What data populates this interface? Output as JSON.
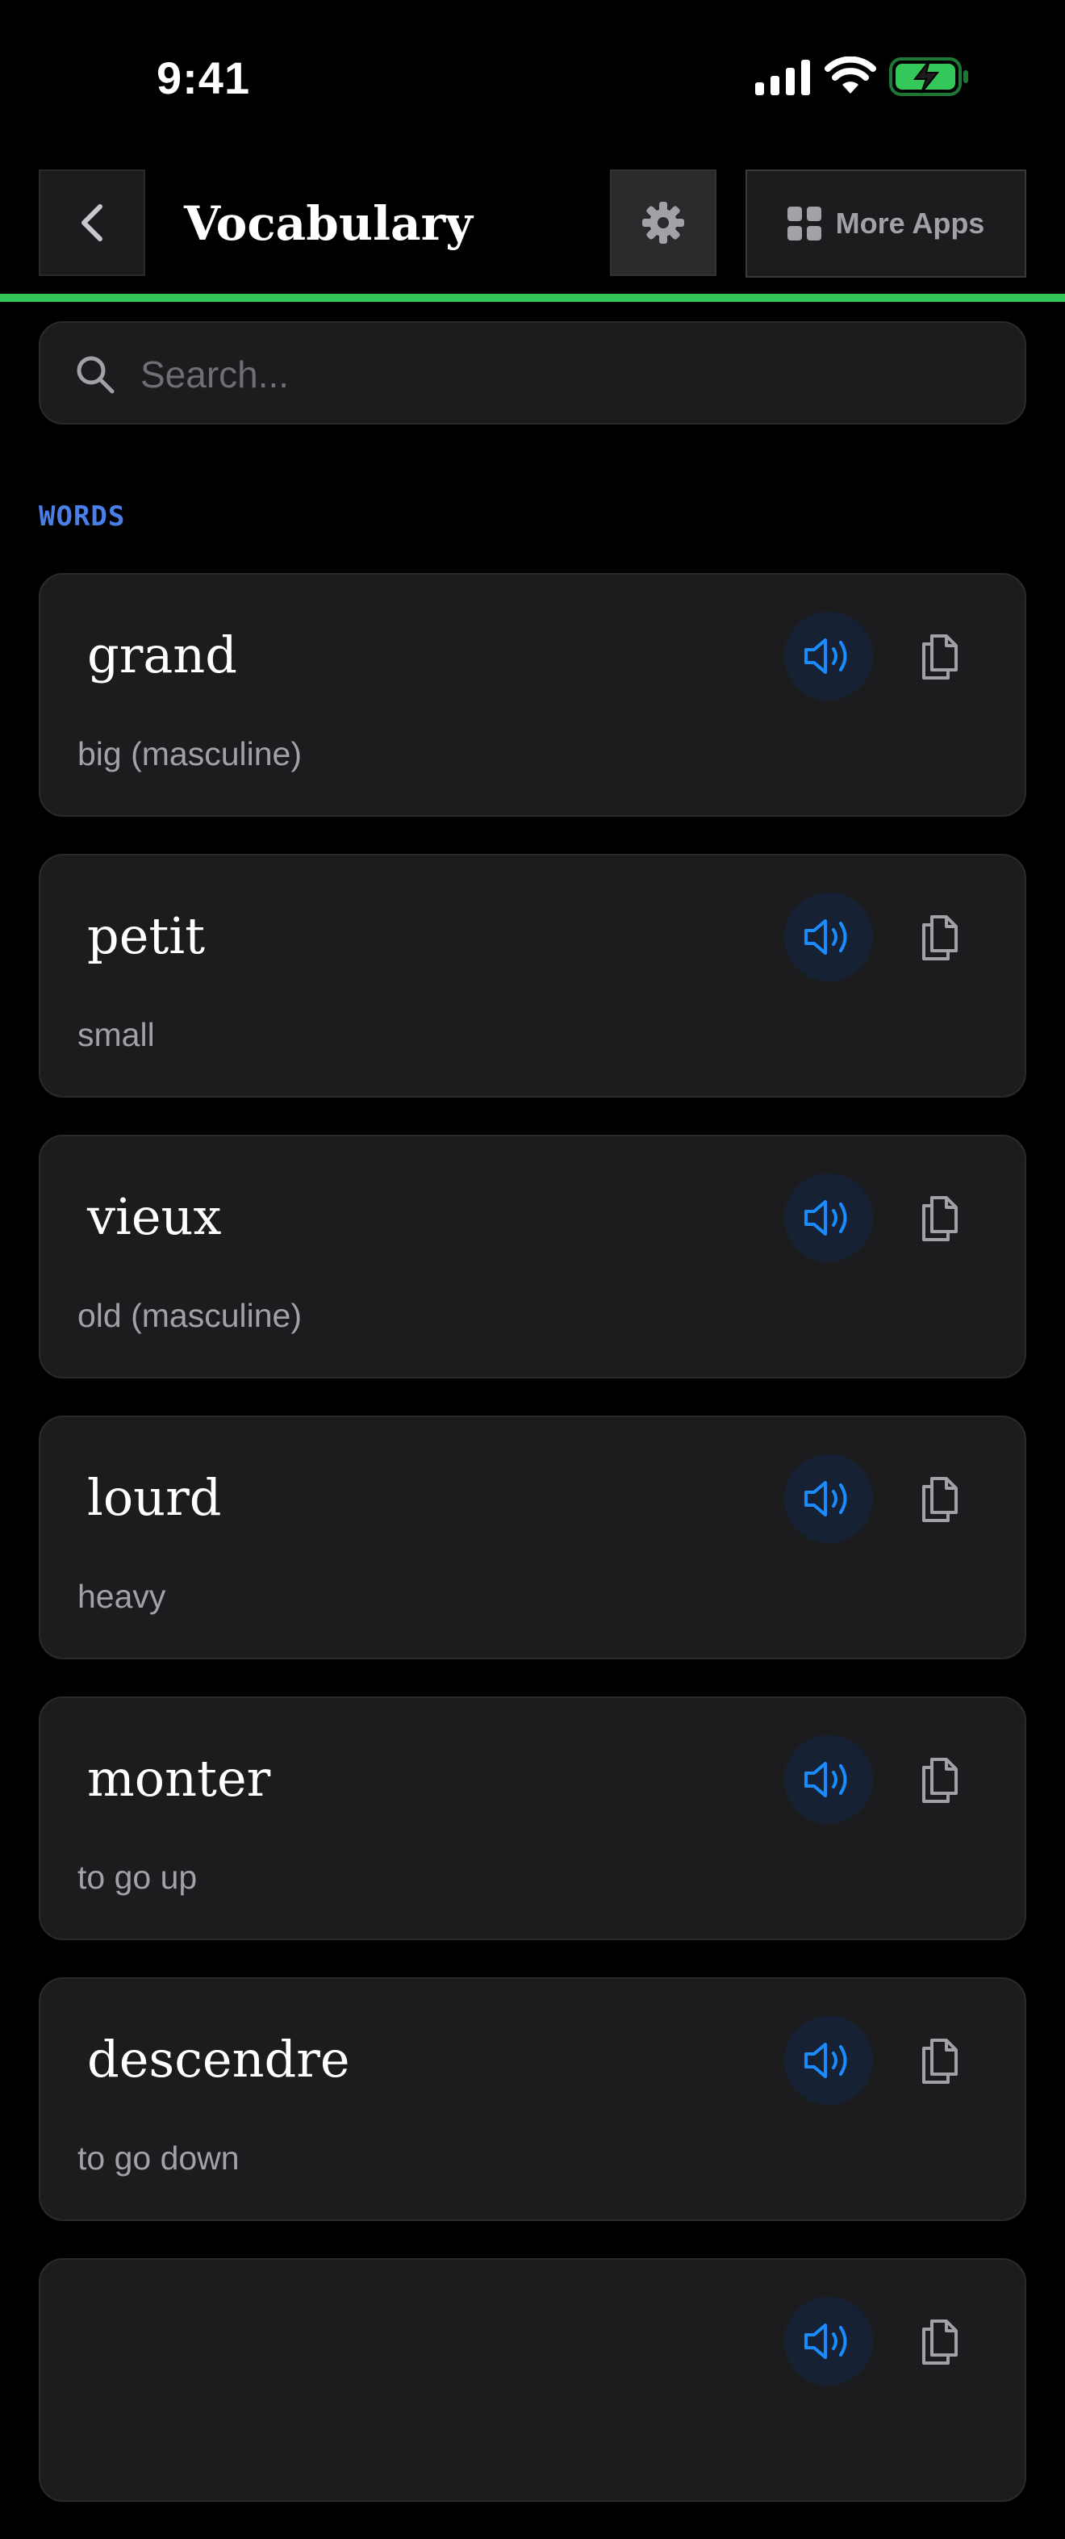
{
  "status_bar": {
    "time": "9:41",
    "icons": [
      "signal-icon",
      "wifi-icon",
      "battery-charging-icon"
    ]
  },
  "header": {
    "back_icon": "chevron-left-icon",
    "title": "Vocabulary",
    "settings_icon": "gear-icon",
    "more_apps_icon": "grid-icon",
    "more_apps_label": "More Apps",
    "progress_fraction": 1.0
  },
  "search": {
    "icon": "search-icon",
    "placeholder": "Search...",
    "value": ""
  },
  "section": {
    "label": "WORDS"
  },
  "words": [
    {
      "term": "grand",
      "translation": "big (masculine)"
    },
    {
      "term": "petit",
      "translation": "small"
    },
    {
      "term": "vieux",
      "translation": "old (masculine)"
    },
    {
      "term": "lourd",
      "translation": "heavy"
    },
    {
      "term": "monter",
      "translation": "to go up"
    },
    {
      "term": "descendre",
      "translation": "to go down"
    },
    {
      "term": "",
      "translation": ""
    }
  ],
  "card_icons": {
    "speak": "speaker-icon",
    "copy": "copy-icon"
  },
  "colors": {
    "background": "#000000",
    "card": "#1c1c1e",
    "accent_blue": "#1a8cff",
    "section_label": "#4a7ee8",
    "progress_green": "#34c759",
    "secondary_text": "#a1a1a6"
  }
}
